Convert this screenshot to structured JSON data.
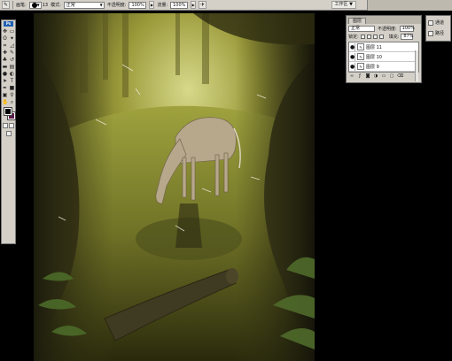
{
  "options_bar": {
    "brush_label": "画笔:",
    "brush_size": "13",
    "mode_label": "模式:",
    "mode_value": "正常",
    "opacity_label": "不透明度:",
    "opacity_value": "100%",
    "flow_label": "流量:",
    "flow_value": "100%",
    "workspace_label": "工作区"
  },
  "layers_panel": {
    "tab_label": "图层",
    "blend_mode": "正常",
    "opacity_label": "不透明度:",
    "opacity_value": "100%",
    "lock_label": "锁定:",
    "fill_label": "填充:",
    "fill_value": "87%",
    "layers": [
      {
        "name": "图层 11"
      },
      {
        "name": "图层 10"
      },
      {
        "name": "图层 9"
      }
    ]
  },
  "mini_panel": {
    "items": [
      {
        "label": "通道"
      },
      {
        "label": "路径"
      }
    ]
  },
  "toolbox": {
    "logo": "Ps"
  },
  "colors": {
    "foreground": "#000000",
    "background": "#5e1b4a",
    "ui_gray": "#d4d0c8"
  }
}
